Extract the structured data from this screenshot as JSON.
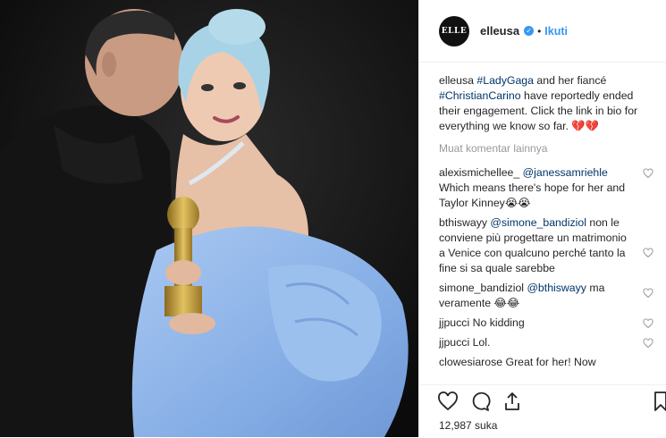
{
  "post": {
    "account_logo": "ELLE",
    "username": "elleusa",
    "follow_label": "Ikuti",
    "separator": "•",
    "caption": {
      "user": "elleusa",
      "tag1": "#LadyGaga",
      "text1": " and her fiancé ",
      "tag2": "#ChristianCarino",
      "text2": " have reportedly ended their engagement. Click the link in bio for everything we know so far. ",
      "emoji": "💔💔"
    },
    "load_more_label": "Muat komentar lainnya",
    "comments": [
      {
        "user": "alexismichellee_",
        "mention": "@janessamriehle",
        "text": " Which means there's hope for her and Taylor Kinney😭😭"
      },
      {
        "user": "bthiswayy",
        "mention": "@simone_bandiziol",
        "text": " non le conviene più progettare un matrimonio a Venice con qualcuno perché tanto la fine si sa quale sarebbe"
      },
      {
        "user": "simone_bandiziol",
        "mention": "@bthiswayy",
        "text": " ma veramente 😂😂"
      },
      {
        "user": "jjpucci",
        "mention": "",
        "text": " No kidding"
      },
      {
        "user": "jjpucci",
        "mention": "",
        "text": " Lol."
      },
      {
        "user": "clowesiarose",
        "mention": "",
        "text": " Great for her! Now"
      }
    ],
    "likes_text": "12,987 suka",
    "colors": {
      "link": "#3897f0",
      "hashtag": "#003569",
      "muted": "#999999",
      "dress": "#8fb6e8"
    },
    "icons": [
      "verified-icon",
      "heart-icon",
      "comment-icon",
      "share-icon",
      "bookmark-icon"
    ]
  }
}
